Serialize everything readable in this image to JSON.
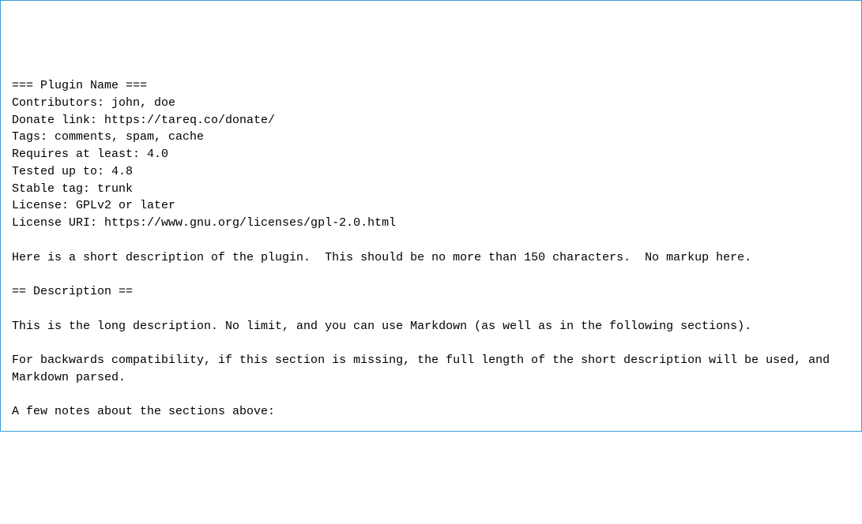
{
  "readme": {
    "lines": [
      "=== Plugin Name ===",
      "Contributors: john, doe",
      "Donate link: https://tareq.co/donate/",
      "Tags: comments, spam, cache",
      "Requires at least: 4.0",
      "Tested up to: 4.8",
      "Stable tag: trunk",
      "License: GPLv2 or later",
      "License URI: https://www.gnu.org/licenses/gpl-2.0.html",
      "",
      "Here is a short description of the plugin.  This should be no more than 150 characters.  No markup here.",
      "",
      "== Description ==",
      "",
      "This is the long description. No limit, and you can use Markdown (as well as in the following sections).",
      "",
      "For backwards compatibility, if this section is missing, the full length of the short description will be used, and",
      "Markdown parsed.",
      "",
      "A few notes about the sections above:",
      ""
    ]
  }
}
